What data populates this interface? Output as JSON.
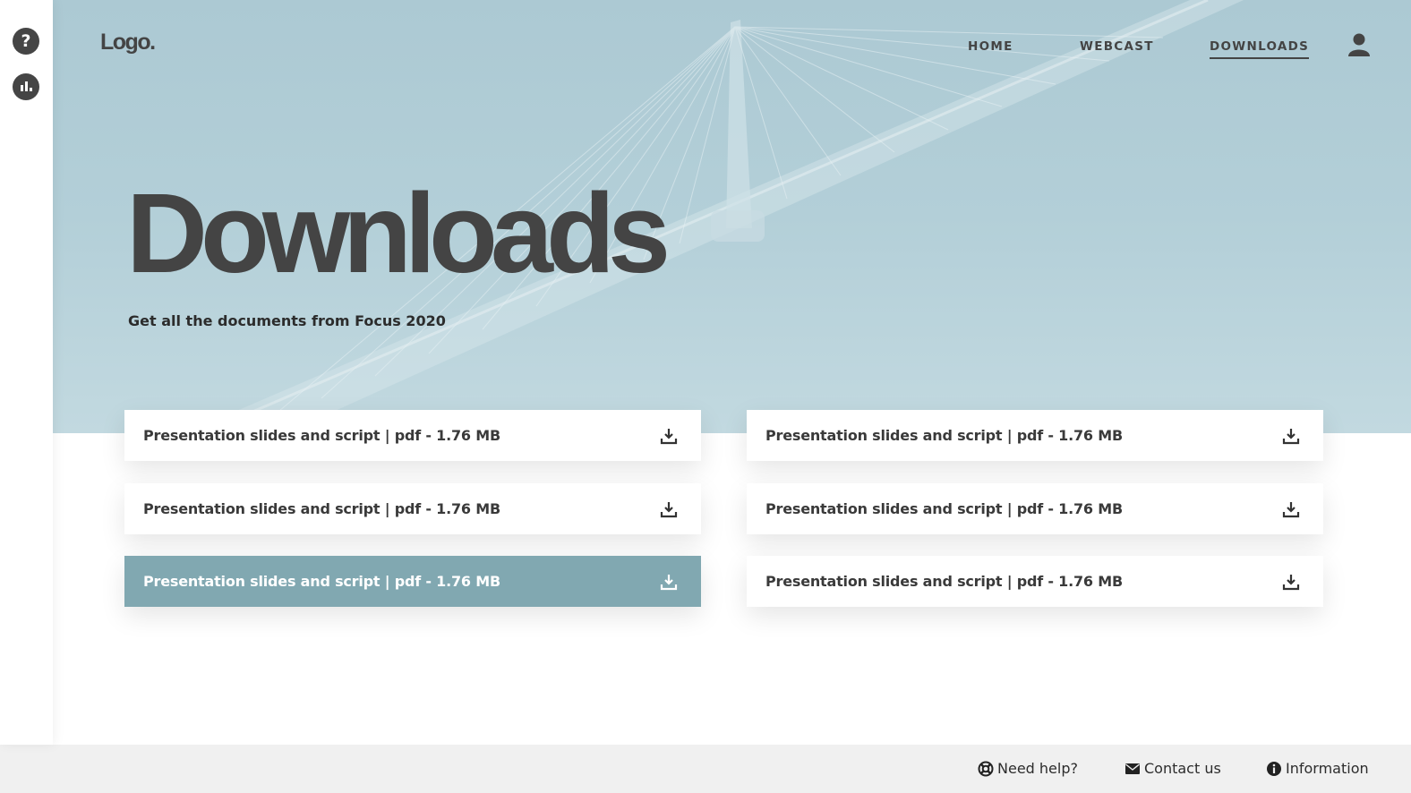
{
  "logo": "Logo.",
  "nav": {
    "items": [
      {
        "label": "HOME"
      },
      {
        "label": "WEBCAST"
      },
      {
        "label": "DOWNLOADS"
      }
    ],
    "active": "DOWNLOADS"
  },
  "sidebar": {
    "icons": [
      "question-circle-icon",
      "bar-chart-icon"
    ]
  },
  "hero": {
    "title": "Downloads",
    "subtitle": "Get all the documents from Focus 2020"
  },
  "downloads": [
    {
      "label": "Presentation slides and script | pdf - 1.76 MB"
    },
    {
      "label": "Presentation slides and script | pdf - 1.76 MB"
    },
    {
      "label": "Presentation slides and script | pdf - 1.76 MB"
    },
    {
      "label": "Presentation slides and script | pdf - 1.76 MB"
    },
    {
      "label": "Presentation slides and script | pdf - 1.76 MB"
    },
    {
      "label": "Presentation slides and script | pdf - 1.76 MB"
    }
  ],
  "footer": {
    "help": "Need help?",
    "contact": "Contact us",
    "info": "Information"
  },
  "colors": {
    "hero_bg": "#b3cfd8",
    "active_card": "#81a8b1",
    "text_dark": "#444444",
    "footer_bg": "#f0f0f0"
  }
}
